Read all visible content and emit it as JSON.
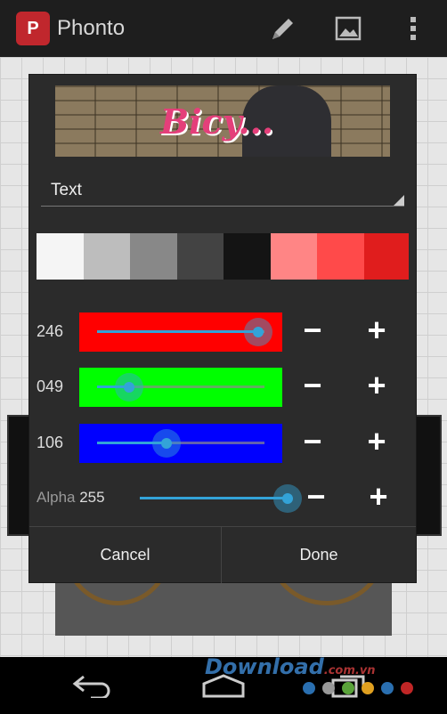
{
  "app": {
    "title": "Phonto",
    "logo_text": "P"
  },
  "actionbar": {
    "icons": [
      "pencil-icon",
      "image-icon",
      "overflow-menu-icon"
    ]
  },
  "preview": {
    "text": "Bicy..."
  },
  "mode": {
    "selected": "Text"
  },
  "swatches": [
    "#f5f5f5",
    "#bdbdbd",
    "#888888",
    "#434343",
    "#141414",
    "#ff8585",
    "#ff4a4a",
    "#e01d1d"
  ],
  "rgb": {
    "red": {
      "value": "246",
      "level": 246,
      "color": "#ff0000"
    },
    "green": {
      "value": "049",
      "level": 49,
      "color": "#00ff00"
    },
    "blue": {
      "value": "106",
      "level": 106,
      "color": "#0000ff"
    }
  },
  "alpha": {
    "label": "Alpha",
    "value": "255",
    "level": 255
  },
  "buttons": {
    "minus": "−",
    "plus": "+",
    "cancel": "Cancel",
    "done": "Done"
  },
  "nav": {
    "icons": [
      "back-icon",
      "home-icon",
      "recents-icon"
    ]
  },
  "watermark": {
    "text": "Download",
    "suffix": ".com.vn"
  },
  "colors": {
    "accent": "#33a3d8",
    "dialog_bg": "#2b2b2b"
  }
}
